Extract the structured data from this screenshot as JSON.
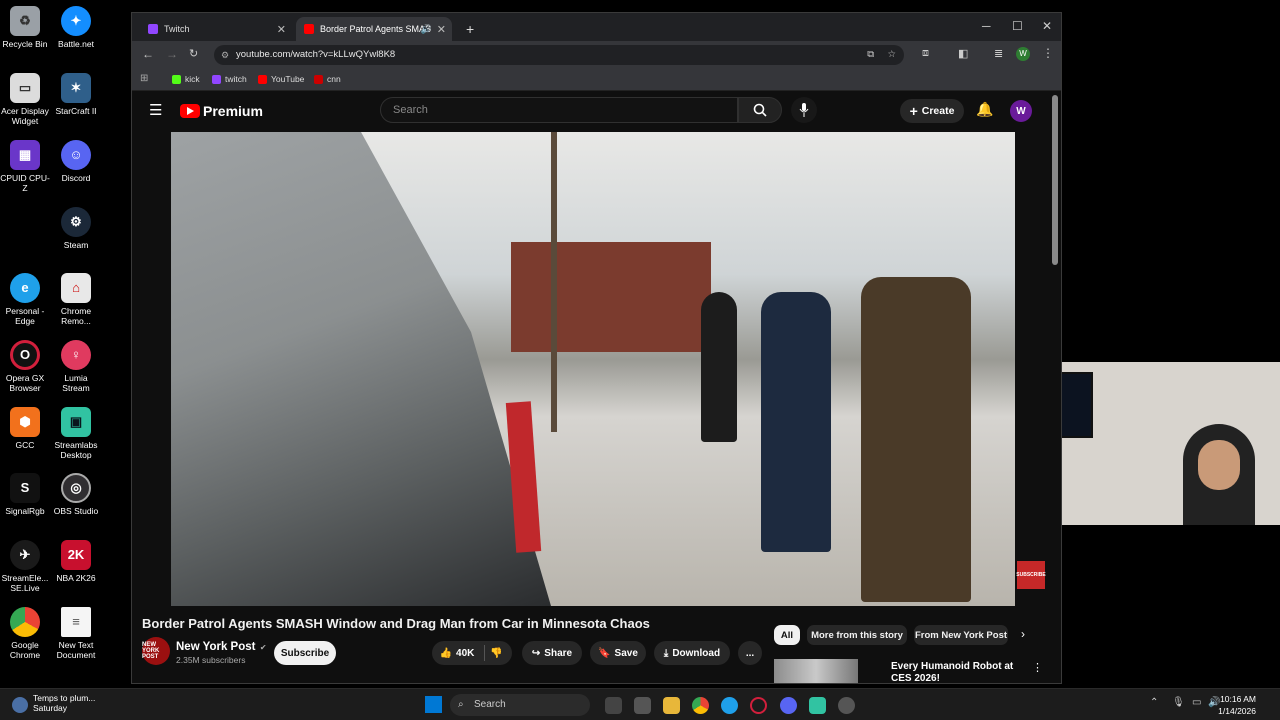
{
  "desktop": {
    "icons": [
      {
        "label": "Recycle Bin",
        "color": "#9aa0a6"
      },
      {
        "label": "Battle.net",
        "color": "#148eff"
      },
      {
        "label": "Acer Display Widget",
        "color": "#dcdcdc"
      },
      {
        "label": "StarCraft II",
        "color": "#2f5f8a"
      },
      {
        "label": "CPUID CPU-Z",
        "color": "#6a36c9"
      },
      {
        "label": "Discord",
        "color": "#5865f2"
      },
      {
        "label": "Steam",
        "color": "#1b2838"
      },
      {
        "label": "Personal - Edge",
        "color": "#1fa0ea"
      },
      {
        "label": "Chrome Remo...",
        "color": "#e8e8e8"
      },
      {
        "label": "Opera GX Browser",
        "color": "#d21f3c"
      },
      {
        "label": "Lumia Stream",
        "color": "#e03a5f"
      },
      {
        "label": "GCC",
        "color": "#f2711c"
      },
      {
        "label": "Streamlabs Desktop",
        "color": "#31c3a2"
      },
      {
        "label": "SignalRgb",
        "color": "#ffffff"
      },
      {
        "label": "OBS Studio",
        "color": "#302e31"
      },
      {
        "label": "StreamEle... SE.Live",
        "color": "#1a1a1a"
      },
      {
        "label": "NBA 2K26",
        "color": "#c8102e"
      },
      {
        "label": "Google Chrome",
        "color": "#34a853"
      },
      {
        "label": "New Text Document",
        "color": "#f5f5f5"
      }
    ]
  },
  "browser": {
    "tabs": [
      {
        "label": "Twitch",
        "favicon_color": "#9146ff"
      },
      {
        "label": "Border Patrol Agents SMAS",
        "favicon_color": "#ff0000"
      }
    ],
    "new_tab": "+",
    "url": "youtube.com/watch?v=kLLwQYwl8K8",
    "profile_initial": "W",
    "bookmarks": [
      {
        "label": "kick",
        "color": "#53fc18"
      },
      {
        "label": "twitch",
        "color": "#9146ff"
      },
      {
        "label": "YouTube",
        "color": "#ff0000"
      },
      {
        "label": "cnn",
        "color": "#cc0000"
      }
    ]
  },
  "youtube": {
    "logo_text": "Premium",
    "search_placeholder": "Search",
    "create_label": "Create",
    "avatar_initial": "W",
    "video_title": "Border Patrol Agents SMASH Window and Drag Man from Car in Minnesota Chaos",
    "channel": {
      "name": "New York Post",
      "subscribers": "2.35M subscribers",
      "avatar_text": "NEW YORK POST"
    },
    "subscribe_label": "Subscribe",
    "likes": "40K",
    "share_label": "Share",
    "save_label": "Save",
    "download_label": "Download",
    "more_label": "...",
    "video_overlay_badge": "SUBSCRIBE",
    "chips": [
      "All",
      "More from this story",
      "From New York Post"
    ],
    "recommended": [
      {
        "title": "Every Humanoid Robot at CES 2026!"
      }
    ]
  },
  "taskbar": {
    "weather_line1": "Temps to plum...",
    "weather_line2": "Saturday",
    "search_label": "Search",
    "time": "10:16 AM",
    "date": "1/14/2026"
  }
}
